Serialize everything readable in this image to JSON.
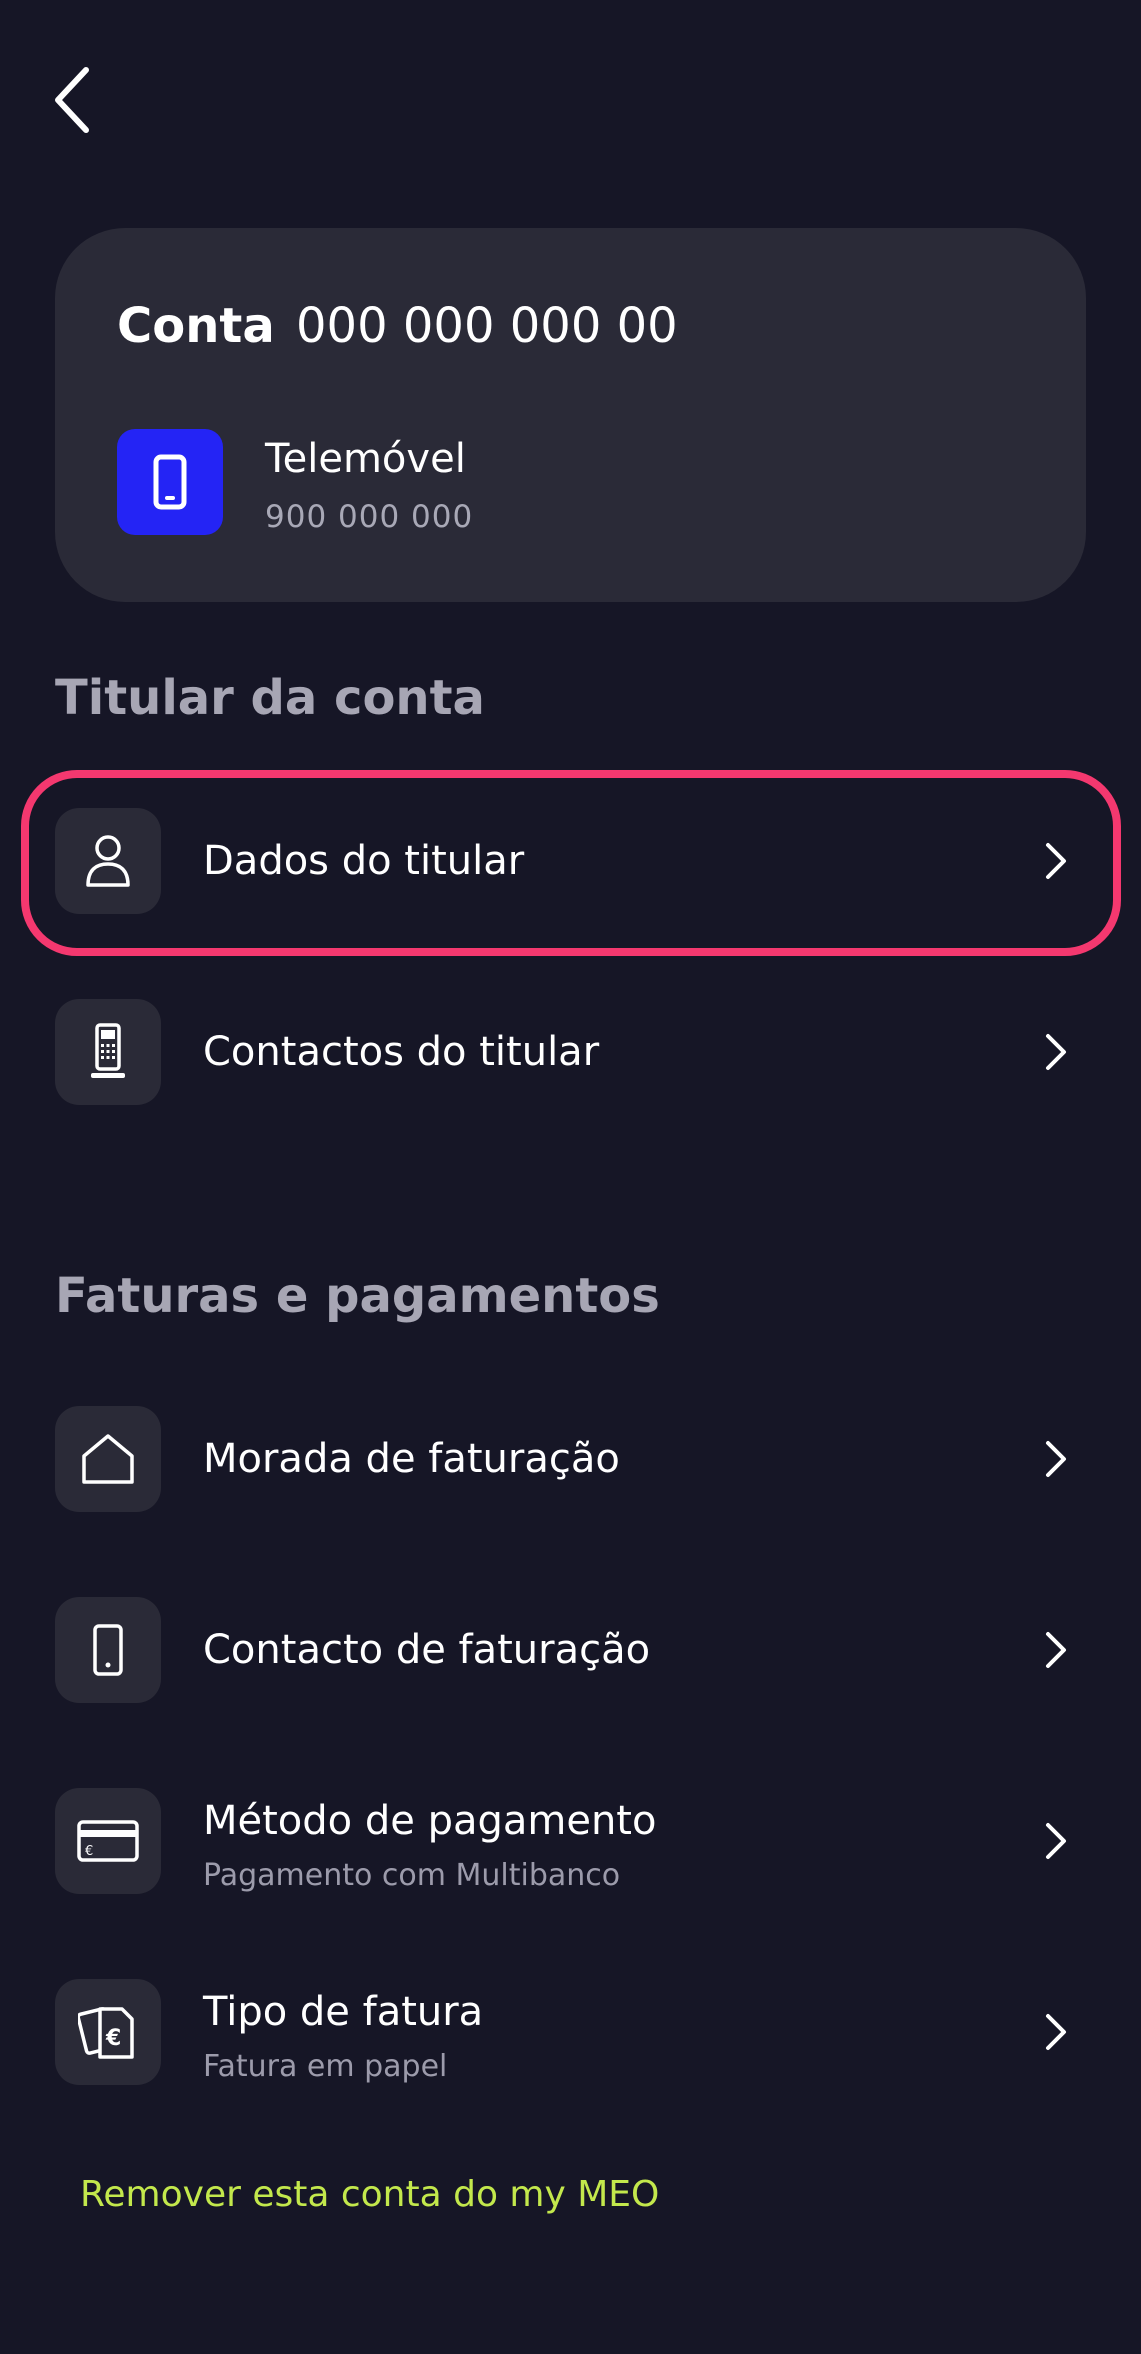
{
  "header": {
    "back_icon": "chevron-left-icon"
  },
  "account_card": {
    "title_label": "Conta",
    "account_number": "000 000 000 00",
    "service_icon": "mobile-phone-icon",
    "service_icon_color": "#2424f5",
    "service_name": "Telemóvel",
    "service_number": "900 000 000"
  },
  "sections": {
    "holder": {
      "title": "Titular da conta",
      "items": [
        {
          "label": "Dados do titular",
          "icon": "user-icon"
        },
        {
          "label": "Contactos do titular",
          "icon": "desk-phone-icon"
        }
      ]
    },
    "billing": {
      "title": "Faturas e pagamentos",
      "items": [
        {
          "label": "Morada de faturação",
          "icon": "house-icon"
        },
        {
          "label": "Contacto de faturação",
          "icon": "mobile-phone-icon"
        },
        {
          "label": "Método de pagamento",
          "sublabel": "Pagamento com Multibanco",
          "icon": "credit-card-icon"
        },
        {
          "label": "Tipo de fatura",
          "sublabel": "Fatura em papel",
          "icon": "invoice-euro-icon"
        }
      ]
    }
  },
  "remove_link": "Remover esta conta do my MEO",
  "colors": {
    "background": "#161626",
    "card": "#2a2a37",
    "highlight": "#f4386f",
    "link": "#c3e84c",
    "section_title": "#a7a6b4"
  }
}
